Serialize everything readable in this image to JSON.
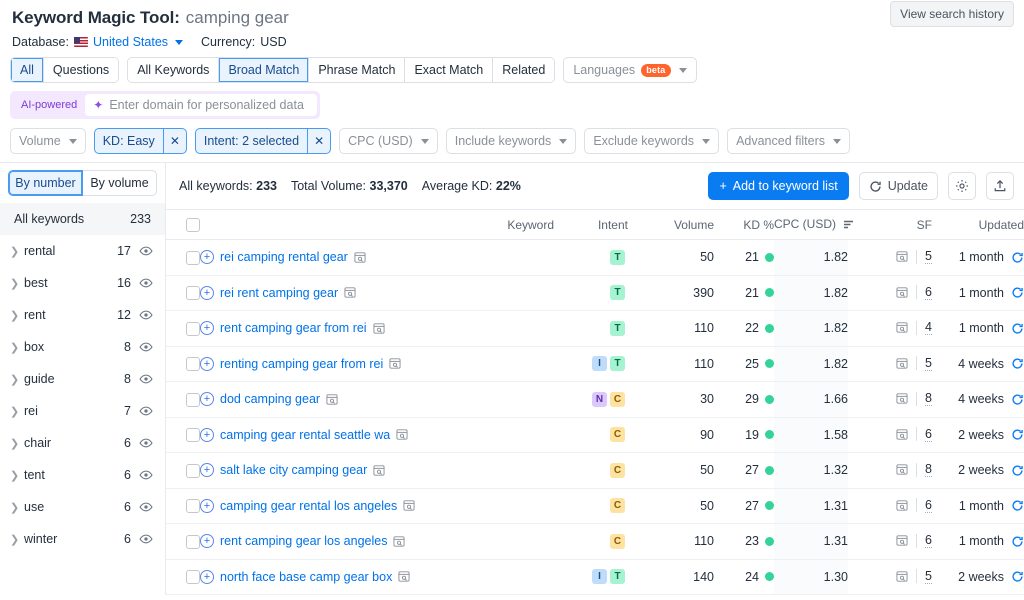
{
  "header": {
    "title": "Keyword Magic Tool:",
    "keyword": "camping gear",
    "database_label": "Database:",
    "database_value": "United States",
    "currency_label": "Currency:",
    "currency_value": "USD",
    "view_history_button": "View search history"
  },
  "match_tabs": [
    {
      "label": "All",
      "active": true
    },
    {
      "label": "Questions",
      "active": false
    },
    {
      "label": "All Keywords",
      "active": false
    },
    {
      "label": "Broad Match",
      "active": true
    },
    {
      "label": "Phrase Match",
      "active": false
    },
    {
      "label": "Exact Match",
      "active": false
    },
    {
      "label": "Related",
      "active": false
    }
  ],
  "languages": {
    "label": "Languages",
    "badge": "beta"
  },
  "ai_domain": {
    "badge": "AI-powered",
    "placeholder": "Enter domain for personalized data",
    "value": ""
  },
  "filter_chips": [
    {
      "label": "Volume",
      "selected": false,
      "removable": false
    },
    {
      "label": "KD: Easy",
      "selected": true,
      "removable": true
    },
    {
      "label": "Intent: 2 selected",
      "selected": true,
      "removable": true
    },
    {
      "label": "CPC (USD)",
      "selected": false,
      "removable": false
    },
    {
      "label": "Include keywords",
      "selected": false,
      "removable": false
    },
    {
      "label": "Exclude keywords",
      "selected": false,
      "removable": false
    },
    {
      "label": "Advanced filters",
      "selected": false,
      "removable": false
    }
  ],
  "sidebar": {
    "toggle": [
      {
        "label": "By number",
        "active": true
      },
      {
        "label": "By volume",
        "active": false
      }
    ],
    "all_keywords_label": "All keywords",
    "all_keywords_count": "233",
    "items": [
      {
        "label": "rental",
        "count": "17"
      },
      {
        "label": "best",
        "count": "16"
      },
      {
        "label": "rent",
        "count": "12"
      },
      {
        "label": "box",
        "count": "8"
      },
      {
        "label": "guide",
        "count": "8"
      },
      {
        "label": "rei",
        "count": "7"
      },
      {
        "label": "chair",
        "count": "6"
      },
      {
        "label": "tent",
        "count": "6"
      },
      {
        "label": "use",
        "count": "6"
      },
      {
        "label": "winter",
        "count": "6"
      }
    ]
  },
  "toolbar": {
    "all_keywords_label": "All keywords:",
    "all_keywords_value": "233",
    "total_volume_label": "Total Volume:",
    "total_volume_value": "33,370",
    "average_kd_label": "Average KD:",
    "average_kd_value": "22%",
    "add_to_list_button": "Add to keyword list",
    "update_button": "Update",
    "settings_button": "settings",
    "export_button": "export"
  },
  "table": {
    "columns": {
      "keyword": "Keyword",
      "intent": "Intent",
      "volume": "Volume",
      "kd": "KD %",
      "cpc": "CPC (USD)",
      "sf": "SF",
      "updated": "Updated"
    },
    "sorted_column": "cpc",
    "rows": [
      {
        "keyword": "rei camping rental gear",
        "intents": [
          "T"
        ],
        "volume": "50",
        "kd": "21",
        "cpc": "1.82",
        "sf": "5",
        "updated": "1 month"
      },
      {
        "keyword": "rei rent camping gear",
        "intents": [
          "T"
        ],
        "volume": "390",
        "kd": "21",
        "cpc": "1.82",
        "sf": "6",
        "updated": "1 month"
      },
      {
        "keyword": "rent camping gear from rei",
        "intents": [
          "T"
        ],
        "volume": "110",
        "kd": "22",
        "cpc": "1.82",
        "sf": "4",
        "updated": "1 month"
      },
      {
        "keyword": "renting camping gear from rei",
        "intents": [
          "I",
          "T"
        ],
        "volume": "110",
        "kd": "25",
        "cpc": "1.82",
        "sf": "5",
        "updated": "4 weeks"
      },
      {
        "keyword": "dod camping gear",
        "intents": [
          "N",
          "C"
        ],
        "volume": "30",
        "kd": "29",
        "cpc": "1.66",
        "sf": "8",
        "updated": "4 weeks"
      },
      {
        "keyword": "camping gear rental seattle wa",
        "intents": [
          "C"
        ],
        "volume": "90",
        "kd": "19",
        "cpc": "1.58",
        "sf": "6",
        "updated": "2 weeks"
      },
      {
        "keyword": "salt lake city camping gear",
        "intents": [
          "C"
        ],
        "volume": "50",
        "kd": "27",
        "cpc": "1.32",
        "sf": "8",
        "updated": "2 weeks"
      },
      {
        "keyword": "camping gear rental los angeles",
        "intents": [
          "C"
        ],
        "volume": "50",
        "kd": "27",
        "cpc": "1.31",
        "sf": "6",
        "updated": "1 month"
      },
      {
        "keyword": "rent camping gear los angeles",
        "intents": [
          "C"
        ],
        "volume": "110",
        "kd": "23",
        "cpc": "1.31",
        "sf": "6",
        "updated": "1 month"
      },
      {
        "keyword": "north face base camp gear box",
        "intents": [
          "I",
          "T"
        ],
        "volume": "140",
        "kd": "24",
        "cpc": "1.30",
        "sf": "5",
        "updated": "2 weeks"
      }
    ]
  },
  "colors": {
    "accent_blue": "#0A7CF2",
    "link_blue": "#0072E8",
    "kd_easy_green": "#34D399",
    "ai_purple": "#7D3BD6",
    "beta_orange": "#FF642D"
  }
}
